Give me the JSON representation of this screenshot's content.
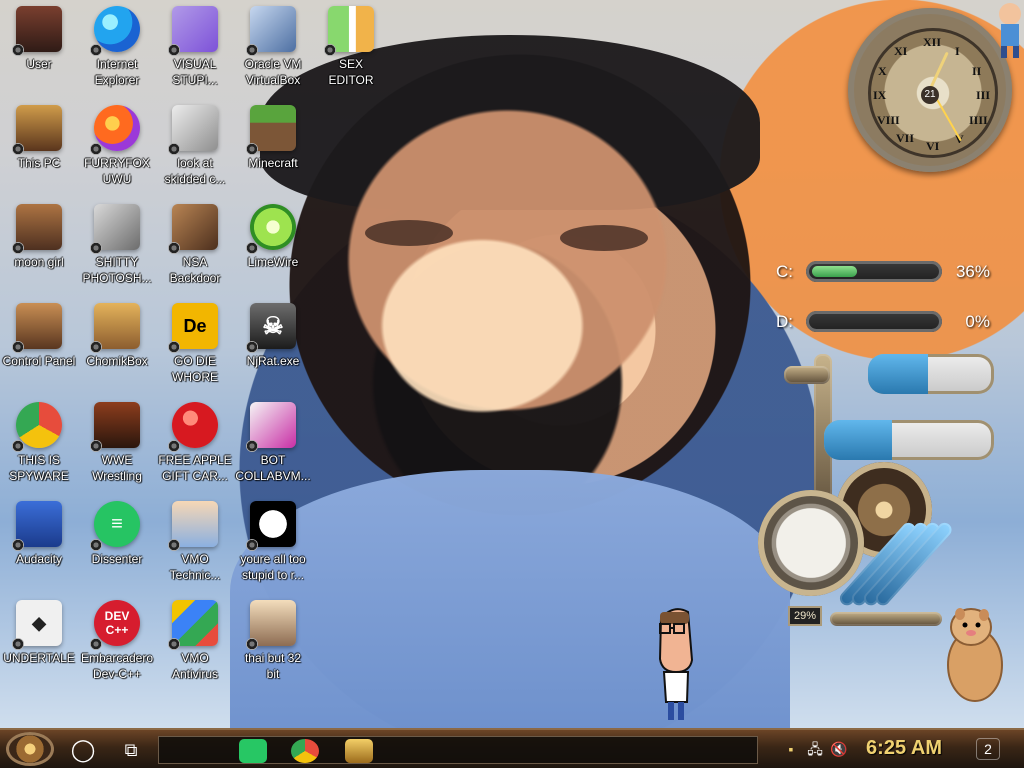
{
  "desktop": {
    "icons": [
      {
        "label": "User"
      },
      {
        "label": "Internet\nExplorer"
      },
      {
        "label": "VISUAL\nSTUPI..."
      },
      {
        "label": "Oracle VM\nVirtualBox"
      },
      {
        "label": "SEX\nEDITOR"
      },
      {
        "label": "This PC"
      },
      {
        "label": "FURRYFOX\nUWU"
      },
      {
        "label": "look at\nskidded c..."
      },
      {
        "label": "Minecraft"
      },
      {
        "label": "moon girl"
      },
      {
        "label": "SHITTY\nPHOTOSH..."
      },
      {
        "label": "NSA\nBackdoor"
      },
      {
        "label": "LimeWire"
      },
      {
        "label": "Control Panel"
      },
      {
        "label": "ChomikBox"
      },
      {
        "label": "GO DIE\nWHORE"
      },
      {
        "label": "NjRat.exe"
      },
      {
        "label": "THIS IS\nSPYWARE"
      },
      {
        "label": "WWE\nWrestling"
      },
      {
        "label": "FREE APPLE\nGIFT CAR..."
      },
      {
        "label": "BOT\nCOLLABVM..."
      },
      {
        "label": "Audacity"
      },
      {
        "label": "Dissenter"
      },
      {
        "label": "VMO\nTechnic..."
      },
      {
        "label": "youre all too\nstupid to r..."
      },
      {
        "label": "UNDERTALE"
      },
      {
        "label": "Embarcadero\nDev-C++"
      },
      {
        "label": "VMO\nAntivirus"
      },
      {
        "label": "thai but 32\nbit"
      }
    ]
  },
  "widgets": {
    "clock": {
      "numerals": [
        "XII",
        "I",
        "II",
        "III",
        "IIII",
        "V",
        "VI",
        "VII",
        "VIII",
        "IX",
        "X",
        "XI"
      ],
      "date": "21"
    },
    "meters": [
      {
        "label": "C:",
        "value": "36%",
        "fraction": 0.36
      },
      {
        "label": "D:",
        "value": "0%",
        "fraction": 0.0
      }
    ],
    "gauge_readout": "29%"
  },
  "taskbar": {
    "time": "6:25 AM",
    "notification_count": "2",
    "search_glyph": "◯",
    "taskview_glyph": "⧉",
    "tray_network_glyph": "🖧",
    "tray_volume_glyph": "🔇"
  },
  "colors": {
    "desktop_label": "#ffffff",
    "taskbar_time": "#f0d170",
    "meter_fill": "#3aa24d",
    "water_fill": "#2a79af"
  }
}
